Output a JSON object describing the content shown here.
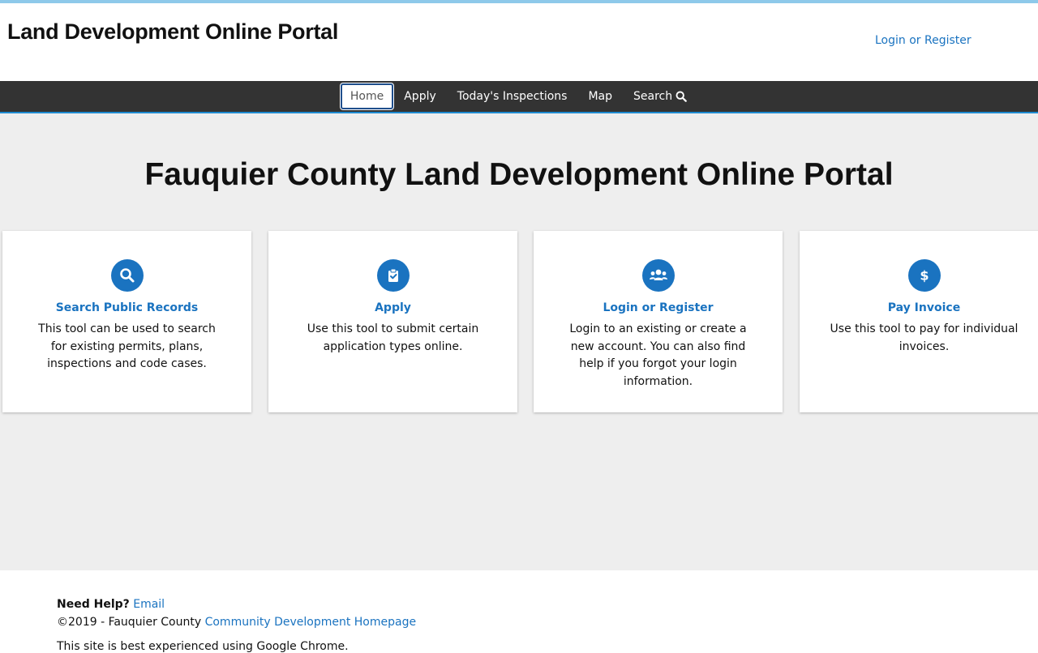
{
  "header": {
    "site_title": "Land Development Online Portal",
    "login_link": "Login or Register"
  },
  "nav": {
    "items": [
      {
        "label": "Home",
        "active": true
      },
      {
        "label": "Apply"
      },
      {
        "label": "Today's Inspections"
      },
      {
        "label": "Map"
      },
      {
        "label": "Search",
        "icon": "search-icon"
      }
    ]
  },
  "main": {
    "hero_title": "Fauquier County Land Development Online Portal",
    "cards": [
      {
        "icon": "search-icon",
        "title": "Search Public Records",
        "description": "This tool can be used to search for existing permits, plans, inspections and code cases."
      },
      {
        "icon": "clipboard-check-icon",
        "title": "Apply",
        "description": "Use this tool to submit certain application types online."
      },
      {
        "icon": "users-icon",
        "title": "Login or Register",
        "description": "Login to an existing or create a new account. You can also find help if you forgot your login information."
      },
      {
        "icon": "dollar-icon",
        "title": "Pay Invoice",
        "description": "Use this tool to pay for individual invoices."
      }
    ]
  },
  "footer": {
    "need_help_label": "Need Help?",
    "email_link": "Email",
    "copyright": "©2019 - Fauquier County",
    "homepage_link": "Community Development Homepage",
    "browser_note": "This site is best experienced using Google Chrome."
  },
  "colors": {
    "accent": "#1a73c0",
    "navbar": "#333333",
    "page_bg": "#eeeeee"
  }
}
